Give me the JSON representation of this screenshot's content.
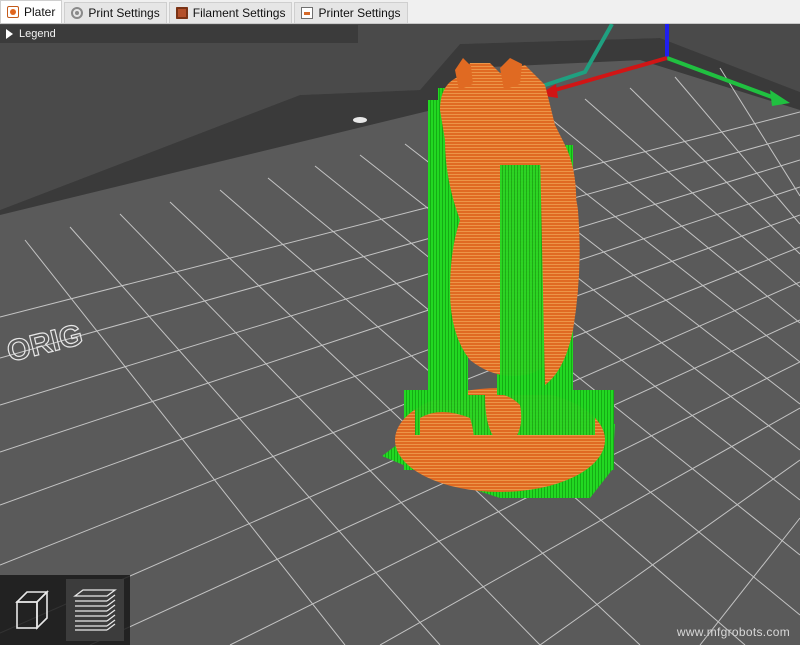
{
  "tabs": [
    {
      "label": "Plater",
      "icon": "plater-icon",
      "active": true
    },
    {
      "label": "Print Settings",
      "icon": "gear-icon",
      "active": false
    },
    {
      "label": "Filament Settings",
      "icon": "filament-spool-icon",
      "active": false
    },
    {
      "label": "Printer Settings",
      "icon": "printer-icon",
      "active": false
    }
  ],
  "legend": {
    "label": "Legend",
    "icon": "triangle-right-icon"
  },
  "bed": {
    "logo_text": "ORIG"
  },
  "view_toolbar": {
    "buttons": [
      {
        "name": "3d-view-cube-icon"
      },
      {
        "name": "layers-preview-icon"
      }
    ]
  },
  "watermark": "www.mfgrobots.com",
  "colors": {
    "model": "#e06a22",
    "support": "#1fd81f",
    "bed": "#595959",
    "grid": "#d4d4d4",
    "axis_x": "#d11515",
    "axis_y": "#20c040",
    "axis_z": "#1f1ff0"
  }
}
